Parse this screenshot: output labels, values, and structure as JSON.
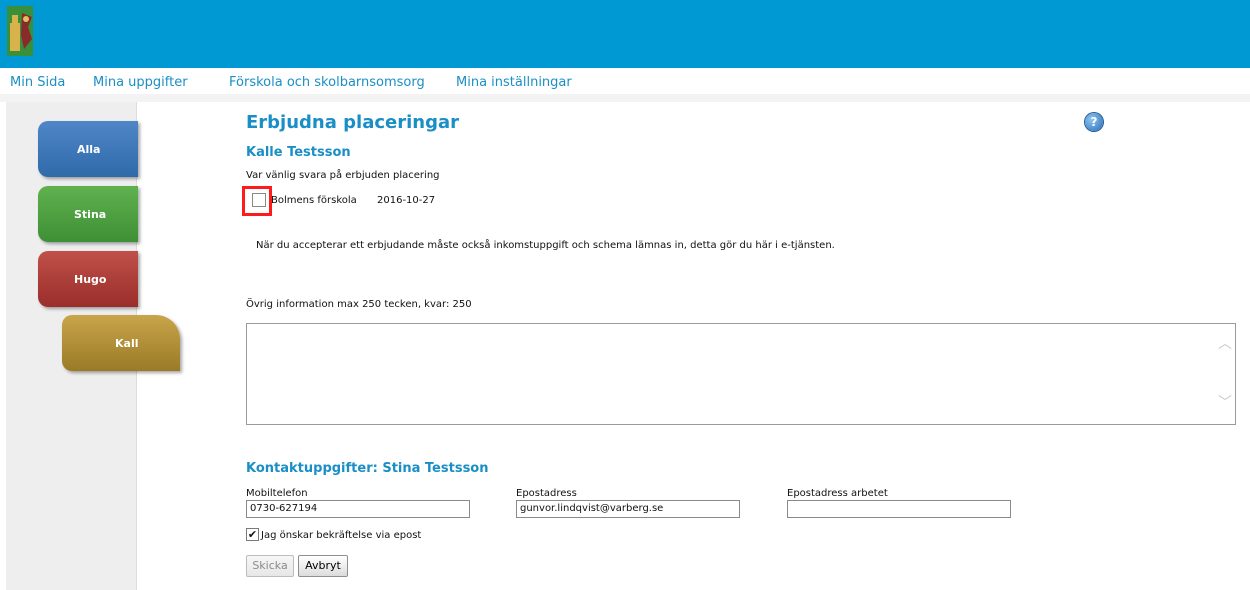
{
  "header": {
    "logo_icon": "municipal-coat-of-arms-icon"
  },
  "nav": {
    "items": [
      {
        "label": "Min Sida"
      },
      {
        "label": "Mina uppgifter"
      },
      {
        "label": "Förskola och skolbarnsomsorg"
      },
      {
        "label": "Mina inställningar"
      }
    ]
  },
  "side_tabs": [
    {
      "label": "Alla",
      "color": "#3b78bc"
    },
    {
      "label": "Stina",
      "color": "#4fa243"
    },
    {
      "label": "Hugo",
      "color": "#b24039"
    },
    {
      "label": "Kall",
      "color": "#b59038"
    }
  ],
  "main": {
    "title": "Erbjudna placeringar",
    "child_name": "Kalle Testsson",
    "instruction": "Var vänlig svara på erbjuden placering",
    "offer": {
      "school": "Bolmens förskola",
      "date": "2016-10-27",
      "checked": false
    },
    "notice": "När du accepterar ett erbjudande måste också inkomstuppgift och schema lämnas in, detta gör du här i e-tjänsten.",
    "other_info_label": "Övrig information max 250 tecken, kvar: 250",
    "other_info_value": ""
  },
  "contact": {
    "title": "Kontaktuppgifter: Stina Testsson",
    "mobile_label": "Mobiltelefon",
    "mobile_value": "0730-627194",
    "email_label": "Epostadress",
    "email_value": "gunvor.lindqvist@varberg.se",
    "work_email_label": "Epostadress arbetet",
    "work_email_value": "",
    "confirm_label": "Jag önskar bekräftelse via epost",
    "confirm_checked": true
  },
  "buttons": {
    "send_label": "Skicka",
    "cancel_label": "Avbryt"
  },
  "colors": {
    "header": "#0199d3",
    "accent": "#1a8fc6",
    "highlight": "#ff1b1b"
  },
  "help_icon": "help-icon"
}
